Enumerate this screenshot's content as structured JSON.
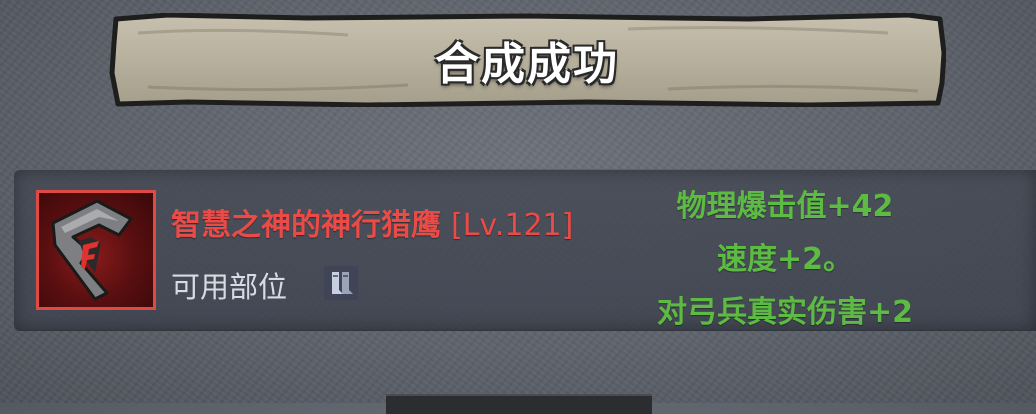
{
  "title": "合成成功",
  "item": {
    "name": "智慧之神的神行猎鹰",
    "level": "[Lv.121]",
    "name_color": "#ea4b47",
    "icon": "falcon-emblem-icon",
    "usable_slots_label": "可用部位",
    "slot_icon": "boots-icon"
  },
  "stats": {
    "color": "#5dbb43",
    "lines": [
      "物理爆击值+42",
      "速度+2。",
      "对弓兵真实伤害+2"
    ]
  }
}
